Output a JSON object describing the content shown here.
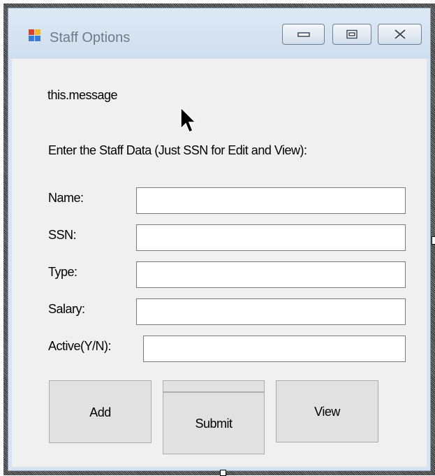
{
  "window": {
    "title": "Staff Options",
    "icon": "app-window-icon",
    "controls": {
      "minimize_icon": "minimize-icon",
      "maximize_icon": "maximize-icon",
      "close_icon": "close-icon"
    }
  },
  "form": {
    "message_label": "this.message",
    "instruction_label": "Enter the Staff Data (Just SSN for Edit and View):",
    "fields": [
      {
        "label": "Name:",
        "value": ""
      },
      {
        "label": "SSN:",
        "value": ""
      },
      {
        "label": "Type:",
        "value": ""
      },
      {
        "label": "Salary:",
        "value": ""
      },
      {
        "label": "Active(Y/N):",
        "value": ""
      }
    ],
    "buttons": {
      "add": "Add",
      "submit": "Submit",
      "view": "View"
    }
  },
  "colors": {
    "window_frame": "#d6e3f1",
    "client_background": "#f0f0f0",
    "button_face": "#e1e1e1"
  }
}
